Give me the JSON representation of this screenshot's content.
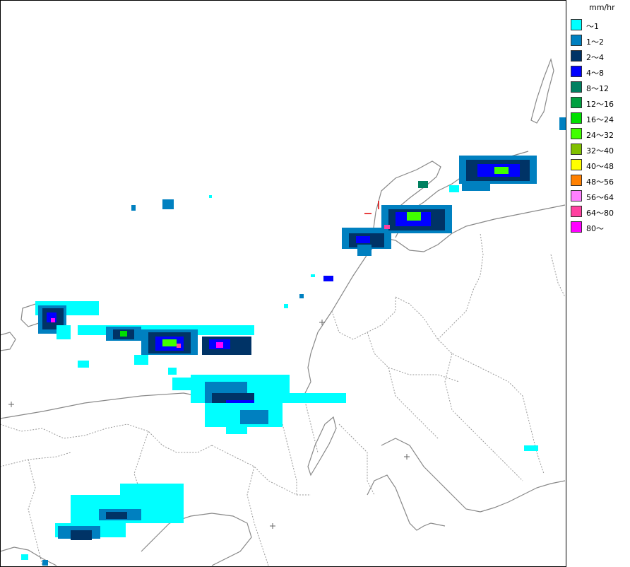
{
  "legend": {
    "unit": "mm/hr",
    "items": [
      {
        "label": "～1",
        "color": "#00ffff"
      },
      {
        "label": "1～2",
        "color": "#0080c0"
      },
      {
        "label": "2～4",
        "color": "#003366"
      },
      {
        "label": "4～8",
        "color": "#0000ff"
      },
      {
        "label": "8～12",
        "color": "#008060"
      },
      {
        "label": "12～16",
        "color": "#00a040"
      },
      {
        "label": "16～24",
        "color": "#00e000"
      },
      {
        "label": "24～32",
        "color": "#40ff00"
      },
      {
        "label": "32～40",
        "color": "#80c000"
      },
      {
        "label": "40～48",
        "color": "#ffff00"
      },
      {
        "label": "48～56",
        "color": "#ff8000"
      },
      {
        "label": "56～64",
        "color": "#ff80ff"
      },
      {
        "label": "64～80",
        "color": "#ff40a0"
      },
      {
        "label": "80～",
        "color": "#ff00ff"
      }
    ]
  },
  "colors": {
    "coast": "#888888",
    "border": "#999999",
    "frame": "#000000"
  },
  "markers": [
    "plus-marker",
    "plus-marker",
    "plus-marker",
    "plus-marker"
  ]
}
